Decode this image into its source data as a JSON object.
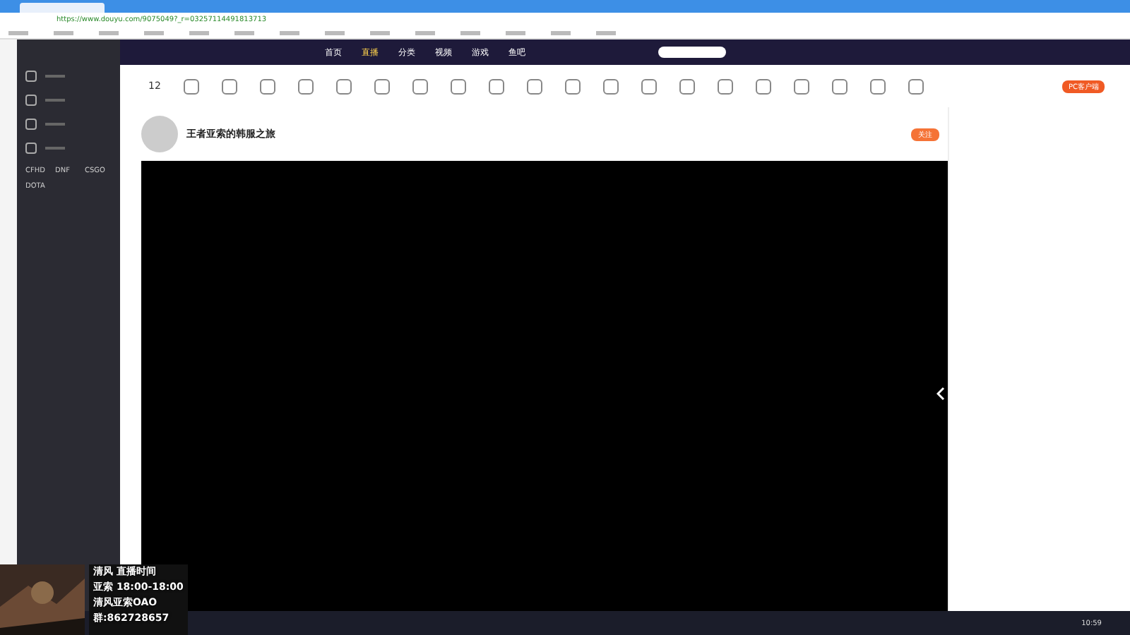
{
  "browser": {
    "url": "https://www.douyu.com/9075049?_r=03257114491813713"
  },
  "nav": [
    {
      "label": "首页",
      "selected": false
    },
    {
      "label": "直播",
      "selected": true
    },
    {
      "label": "分类",
      "selected": false
    },
    {
      "label": "视频",
      "selected": false
    },
    {
      "label": "游戏",
      "selected": false
    },
    {
      "label": "鱼吧",
      "selected": false
    }
  ],
  "level": "12",
  "streamer": {
    "title": "王者亚索的韩服之旅",
    "follow": "关注"
  },
  "sidebar": {
    "games": [
      "CFHD",
      "DNF",
      "CSGO",
      "DOTA"
    ]
  },
  "pc_client": "PC客户端",
  "overlay": {
    "name": "清风",
    "name2": "亚索",
    "schedule_label": "直播时间",
    "schedule": "18:00-18:00",
    "douyin": "清风亚索OAO",
    "group": "群:862728657"
  },
  "clock": "10:59"
}
